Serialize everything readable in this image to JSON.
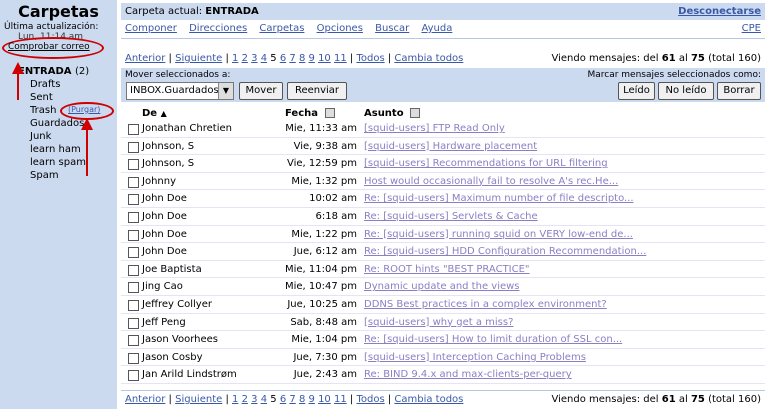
{
  "sidebar": {
    "title": "Carpetas",
    "last_update_label": "Última actualización:",
    "last_update_time": "Lun, 11:14 am",
    "check_mail": "Comprobar correo",
    "folders": {
      "inbox": "ENTRADA",
      "inbox_count": "(2)",
      "drafts": "Drafts",
      "sent": "Sent",
      "trash": "Trash",
      "purge": "(Purgar)",
      "guardados": "Guardados",
      "junk": "Junk",
      "learn_ham": "learn ham",
      "learn_spam": "learn spam",
      "spam": "Spam"
    }
  },
  "header": {
    "current_label": "Carpeta actual:",
    "current_folder": "ENTRADA",
    "logout": "Desconectarse",
    "cpe": "CPE"
  },
  "menu": [
    "Componer",
    "Direcciones",
    "Carpetas",
    "Opciones",
    "Buscar",
    "Ayuda"
  ],
  "pager": {
    "prev": "Anterior",
    "next": "Siguiente",
    "pages": [
      "1",
      "2",
      "3",
      "4",
      "5",
      "6",
      "7",
      "8",
      "9",
      "10",
      "11"
    ],
    "current_page": "5",
    "all": "Todos",
    "toggle": "Cambia todos",
    "viewing_prefix": "Viendo mensajes: del",
    "viewing_from": "61",
    "viewing_mid": "al",
    "viewing_to": "75",
    "viewing_total": "(total 160)"
  },
  "controls": {
    "move_label": "Mover seleccionados a:",
    "move_target": "INBOX.Guardados",
    "move_button": "Mover",
    "forward_button": "Reenviar",
    "mark_label": "Marcar mensajes seleccionados como:",
    "read_button": "Leído",
    "unread_button": "No leído",
    "delete_button": "Borrar"
  },
  "table": {
    "col_from": "De",
    "col_date": "Fecha",
    "col_subject": "Asunto",
    "rows": [
      {
        "from": "Jonathan Chretien",
        "date": "Mie, 11:33 am",
        "subject": "[squid-users] FTP Read Only"
      },
      {
        "from": "Johnson, S",
        "date": "Vie, 9:38 am",
        "subject": "[squid-users] Hardware placement"
      },
      {
        "from": "Johnson, S",
        "date": "Vie, 12:59 pm",
        "subject": "[squid-users] Recommendations for URL filtering"
      },
      {
        "from": "Johnny",
        "date": "Mie, 1:32 pm",
        "subject": "Host would occasionally fail to resolve A's rec.He..."
      },
      {
        "from": "John Doe",
        "date": "10:02 am",
        "subject": "Re: [squid-users] Maximum number of file descripto..."
      },
      {
        "from": "John Doe",
        "date": "6:18 am",
        "subject": "Re: [squid-users] Servlets & Cache"
      },
      {
        "from": "John Doe",
        "date": "Mie, 1:22 pm",
        "subject": "Re: [squid-users] running squid on VERY low-end de..."
      },
      {
        "from": "John Doe",
        "date": "Jue, 6:12 am",
        "subject": "Re: [squid-users] HDD Configuration Recommendation..."
      },
      {
        "from": "Joe Baptista",
        "date": "Mie, 11:04 pm",
        "subject": "Re: ROOT hints \"BEST PRACTICE\""
      },
      {
        "from": "Jing Cao",
        "date": "Mie, 10:47 pm",
        "subject": "Dynamic update and the views"
      },
      {
        "from": "Jeffrey Collyer",
        "date": "Jue, 10:25 am",
        "subject": "DDNS Best practices in a complex environment?"
      },
      {
        "from": "Jeff Peng",
        "date": "Sab, 8:48 am",
        "subject": "[squid-users] why get a miss?"
      },
      {
        "from": "Jason Voorhees",
        "date": "Mie, 1:04 pm",
        "subject": "Re: [squid-users] How to limit duration of SSL con..."
      },
      {
        "from": "Jason Cosby",
        "date": "Jue, 7:30 pm",
        "subject": "[squid-users] Interception Caching Problems"
      },
      {
        "from": "Jan Arild Lindstrøm",
        "date": "Jue, 2:43 am",
        "subject": "Re: BIND 9.4.x and max-clients-per-query"
      }
    ]
  }
}
